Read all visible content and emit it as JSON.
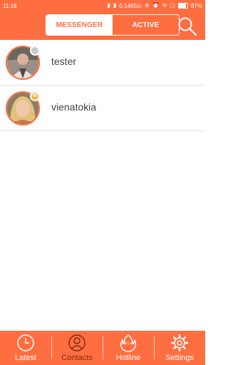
{
  "status_bar": {
    "time": "11:18",
    "speed": "0,14КБ/с",
    "battery_pct": "87%",
    "battery_level": 0.87,
    "icons": [
      "signal-icon",
      "signal-icon",
      "alarm-off-icon",
      "alarm-icon",
      "wifi-icon",
      "sim-icon",
      "battery-icon"
    ]
  },
  "header": {
    "tabs": [
      {
        "label": "MESSENGER",
        "active": true
      },
      {
        "label": "ACTIVE",
        "active": false
      }
    ],
    "search_icon": "search-icon",
    "accent": "#ff6e40"
  },
  "contacts": [
    {
      "name": "tester",
      "status": "offline"
    },
    {
      "name": "vienatokia",
      "status": "bonus",
      "badge": "W"
    }
  ],
  "bottom_nav": [
    {
      "label": "Latest",
      "icon": "clock-icon",
      "selected": false
    },
    {
      "label": "Contacts",
      "icon": "contacts-icon",
      "selected": true
    },
    {
      "label": "Hotline",
      "icon": "hotline-icon",
      "selected": false,
      "icon_text": "HOT LINE"
    },
    {
      "label": "Settings",
      "icon": "gear-icon",
      "selected": false
    }
  ]
}
